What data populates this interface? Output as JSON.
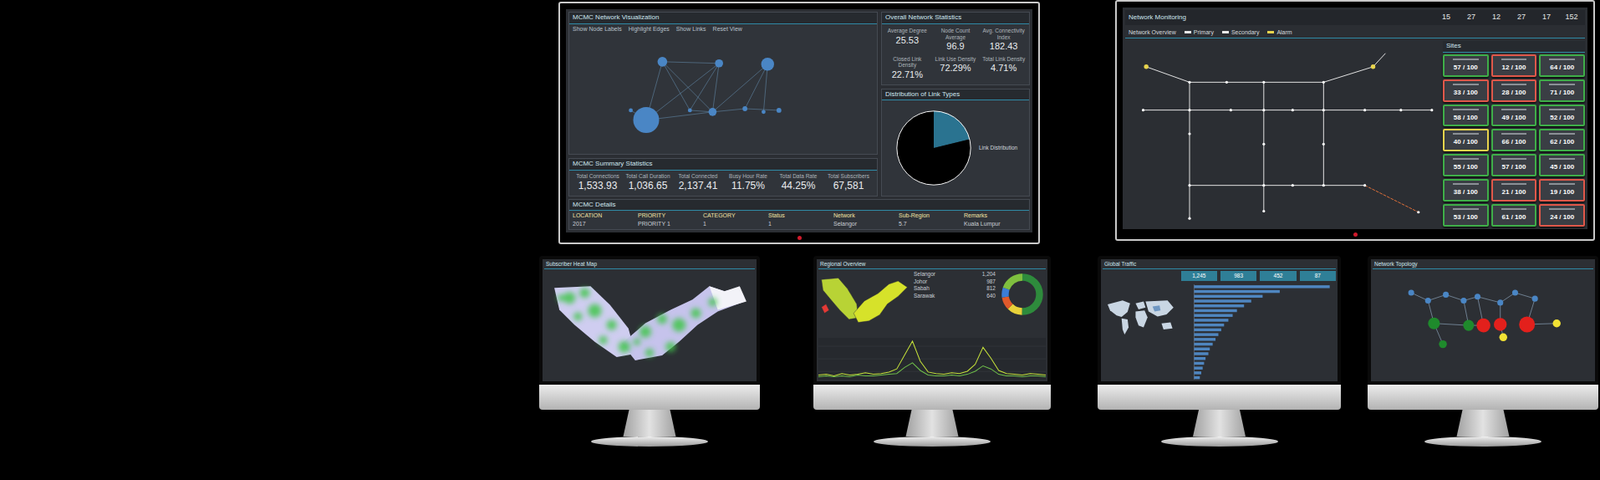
{
  "main_left": {
    "graph": {
      "title": "MCMC Network Visualization",
      "options": [
        "Show Node Labels",
        "Highlight Edges",
        "Show Links",
        "Reset View"
      ]
    },
    "stats": {
      "title": "Overall Network Statistics",
      "items": [
        {
          "label": "Average Degree",
          "value": "25.53"
        },
        {
          "label": "Node Count Average",
          "value": "96.9"
        },
        {
          "label": "Avg. Connectivity Index",
          "value": "182.43"
        },
        {
          "label": "Closed Link Density",
          "value": "22.71%"
        },
        {
          "label": "Link Use Density",
          "value": "72.29%"
        },
        {
          "label": "Total Link Density",
          "value": "4.71%"
        }
      ]
    },
    "pie": {
      "title": "Distribution of Link Types",
      "note": "Link Distribution",
      "slices": [
        {
          "value": 21,
          "color": "#2a7390"
        },
        {
          "value": 79,
          "color": "#000000"
        }
      ]
    },
    "summary": {
      "title": "MCMC Summary Statistics",
      "items": [
        {
          "label": "Total Connections",
          "value": "1,533.93"
        },
        {
          "label": "Total Call Duration",
          "value": "1,036.65"
        },
        {
          "label": "Total Connected",
          "value": "2,137.41"
        },
        {
          "label": "Busy Hour Rate",
          "value": "11.75%"
        },
        {
          "label": "Total Data Rate",
          "value": "44.25%"
        },
        {
          "label": "Total Subscribers",
          "value": "67,581"
        }
      ]
    },
    "table": {
      "title": "MCMC Details",
      "columns": [
        "LOCATION",
        "PRIORITY",
        "CATEGORY",
        "Status",
        "Network",
        "Sub-Region",
        "Remarks"
      ],
      "rows": [
        [
          "2017",
          "PRIORITY 1",
          "1",
          "1",
          "Selangor",
          "5.7",
          "Kuala Lumpur"
        ]
      ]
    }
  },
  "main_right": {
    "title": "Network Monitoring",
    "counts": [
      "15",
      "27",
      "12",
      "27",
      "17",
      "152"
    ],
    "subtitle": "Network Overview",
    "legend": [
      {
        "label": "Primary",
        "color": "#e8e8e8"
      },
      {
        "label": "Secondary",
        "color": "#e8e8e8"
      },
      {
        "label": "Alarm",
        "color": "#e8d44d"
      }
    ],
    "tiles_title": "Sites",
    "tiles": [
      {
        "reading": "57 / 100",
        "color": "#3fae49"
      },
      {
        "reading": "12 / 100",
        "color": "#e0584a"
      },
      {
        "reading": "64 / 100",
        "color": "#3fae49"
      },
      {
        "reading": "33 / 100",
        "color": "#e0584a"
      },
      {
        "reading": "28 / 100",
        "color": "#e0584a"
      },
      {
        "reading": "71 / 100",
        "color": "#3fae49"
      },
      {
        "reading": "58 / 100",
        "color": "#3fae49"
      },
      {
        "reading": "49 / 100",
        "color": "#3fae49"
      },
      {
        "reading": "52 / 100",
        "color": "#3fae49"
      },
      {
        "reading": "40 / 100",
        "color": "#e8d44d"
      },
      {
        "reading": "66 / 100",
        "color": "#3fae49"
      },
      {
        "reading": "62 / 100",
        "color": "#3fae49"
      },
      {
        "reading": "55 / 100",
        "color": "#3fae49"
      },
      {
        "reading": "57 / 100",
        "color": "#3fae49"
      },
      {
        "reading": "45 / 100",
        "color": "#3fae49"
      },
      {
        "reading": "38 / 100",
        "color": "#3fae49"
      },
      {
        "reading": "21 / 100",
        "color": "#e0584a"
      },
      {
        "reading": "19 / 100",
        "color": "#e0584a"
      },
      {
        "reading": "53 / 100",
        "color": "#3fae49"
      },
      {
        "reading": "61 / 100",
        "color": "#3fae49"
      },
      {
        "reading": "24 / 100",
        "color": "#e0584a"
      }
    ]
  },
  "heatmap": {
    "title": "Subscriber Heat Map"
  },
  "regional": {
    "title": "Regional Overview",
    "regions": [
      {
        "color": "#b8d335"
      },
      {
        "color": "#e53935"
      },
      {
        "color": "#d6e22a"
      }
    ],
    "rows": [
      [
        "Selangor",
        "1,204"
      ],
      [
        "Johor",
        "987"
      ],
      [
        "Sabah",
        "812"
      ],
      [
        "Sarawak",
        "640"
      ]
    ],
    "donut": [
      {
        "value": 50,
        "color": "#2e8b3c"
      },
      {
        "value": 12,
        "color": "#e8d23a"
      },
      {
        "value": 10,
        "color": "#e05a2b"
      },
      {
        "value": 8,
        "color": "#3b7dd8"
      },
      {
        "value": 20,
        "color": "#7fbf3f"
      }
    ],
    "series": [
      {
        "values": [
          4,
          5,
          3,
          6,
          4,
          5,
          7,
          5,
          6,
          8,
          12,
          30,
          48,
          22,
          8,
          6,
          5,
          7,
          6,
          9,
          18,
          40,
          26,
          10,
          6,
          5,
          4,
          6,
          5,
          4
        ],
        "color": "#c6e23a"
      },
      {
        "values": [
          2,
          3,
          2,
          3,
          2,
          4,
          3,
          3,
          4,
          5,
          6,
          14,
          20,
          10,
          4,
          3,
          3,
          4,
          3,
          5,
          9,
          16,
          12,
          5,
          3,
          3,
          2,
          3,
          3,
          2
        ],
        "color": "#6fbf4a"
      }
    ]
  },
  "global": {
    "title": "Global Traffic",
    "counts": [
      "1,245",
      "983",
      "452",
      "87"
    ],
    "bars": [
      95,
      60,
      48,
      40,
      35,
      30,
      27,
      24,
      21,
      19,
      17,
      15,
      13,
      11,
      10,
      8,
      7,
      6,
      5,
      4
    ]
  },
  "topology": {
    "title": "Network Topology",
    "nodes": [
      {
        "color": "#4a86c5"
      },
      {
        "color": "#4a86c5"
      },
      {
        "color": "#4a86c5"
      },
      {
        "color": "#4a86c5"
      },
      {
        "color": "#4a86c5"
      },
      {
        "color": "#4a86c5"
      },
      {
        "color": "#4a86c5"
      },
      {
        "color": "#4a86c5"
      },
      {
        "color": "#1f8a2c"
      },
      {
        "color": "#1f8a2c"
      },
      {
        "color": "#1f8a2c"
      },
      {
        "color": "#e3201c"
      },
      {
        "color": "#e3201c"
      },
      {
        "color": "#e3201c"
      },
      {
        "color": "#f2e234"
      },
      {
        "color": "#f2e234"
      }
    ]
  }
}
